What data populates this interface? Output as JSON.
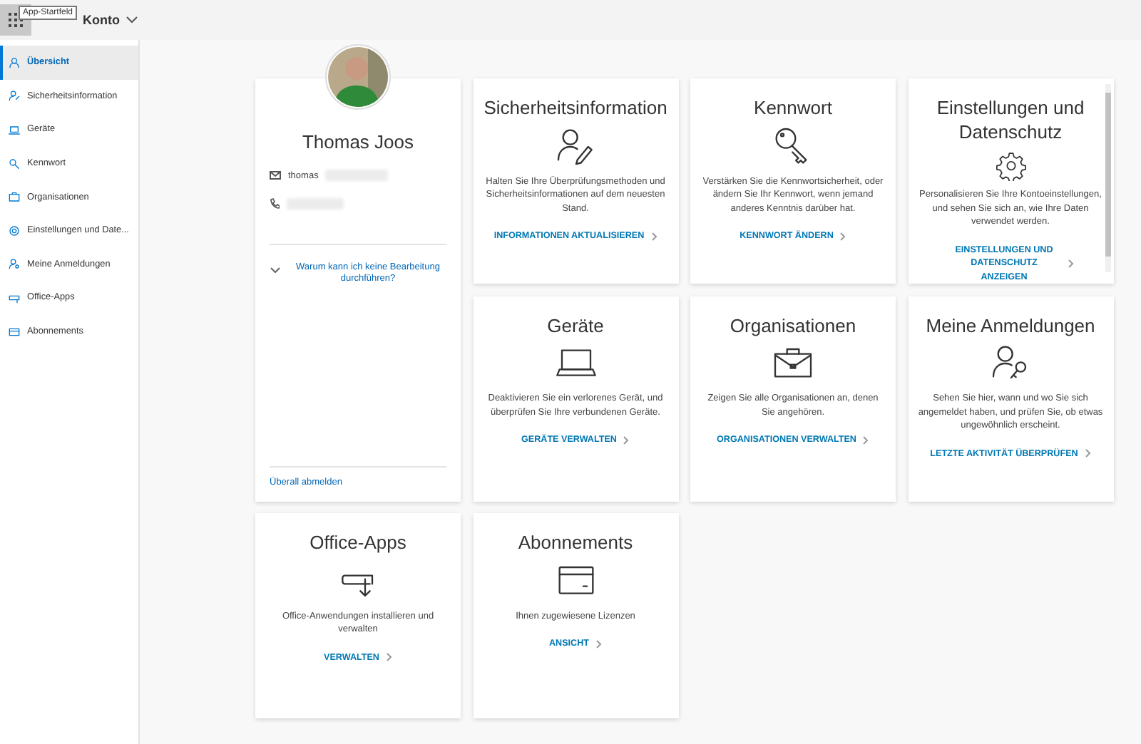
{
  "header": {
    "title": "Konto",
    "tooltip": "App-Startfeld"
  },
  "sidebar": {
    "items": [
      {
        "label": "Übersicht",
        "selected": true
      },
      {
        "label": "Sicherheitsinformation",
        "selected": false
      },
      {
        "label": "Geräte",
        "selected": false
      },
      {
        "label": "Kennwort",
        "selected": false
      },
      {
        "label": "Organisationen",
        "selected": false
      },
      {
        "label": "Einstellungen und Date...",
        "selected": false
      },
      {
        "label": "Meine Anmeldungen",
        "selected": false
      },
      {
        "label": "Office-Apps",
        "selected": false
      },
      {
        "label": "Abonnements",
        "selected": false
      }
    ]
  },
  "profile": {
    "name": "Thomas Joos",
    "email": "thomas",
    "help_link": "Warum kann ich keine Bearbeitung durchführen?",
    "sign_out": "Überall abmelden"
  },
  "cards": [
    {
      "title": "Sicherheitsinformation",
      "description": "Halten Sie Ihre Überprüfungsmethoden und Sicherheitsinformationen auf dem neuesten Stand.",
      "link": "INFORMATIONEN AKTUALISIEREN",
      "scrollable": false
    },
    {
      "title": "Kennwort",
      "description": "Verstärken Sie die Kennwortsicherheit, oder ändern Sie Ihr Kennwort, wenn jemand anderes Kenntnis darüber hat.",
      "link": "KENNWORT ÄNDERN",
      "scrollable": false
    },
    {
      "title": "Einstellungen und Datenschutz",
      "description": "Personalisieren Sie Ihre Kontoeinstellungen, und sehen Sie sich an, wie Ihre Daten verwendet werden.",
      "link": "EINSTELLUNGEN UND DATENSCHUTZ ANZEIGEN",
      "scrollable": true
    },
    {
      "title": "Geräte",
      "description": "Deaktivieren Sie ein verlorenes Gerät, und überprüfen Sie Ihre verbundenen Geräte.",
      "link": "GERÄTE VERWALTEN",
      "scrollable": false
    },
    {
      "title": "Organisationen",
      "description": "Zeigen Sie alle Organisationen an, denen Sie angehören.",
      "link": "ORGANISATIONEN VERWALTEN",
      "scrollable": false
    },
    {
      "title": "Meine Anmeldungen",
      "description": "Sehen Sie hier, wann und wo Sie sich angemeldet haben, und prüfen Sie, ob etwas ungewöhnlich erscheint.",
      "link": "LETZTE AKTIVITÄT ÜBERPRÜFEN",
      "scrollable": false
    },
    {
      "title": "Office-Apps",
      "description": "Office-Anwendungen installieren und verwalten",
      "link": "VERWALTEN",
      "scrollable": false
    },
    {
      "title": "Abonnements",
      "description": "Ihnen zugewiesene Lizenzen",
      "link": "ANSICHT",
      "scrollable": false
    }
  ]
}
